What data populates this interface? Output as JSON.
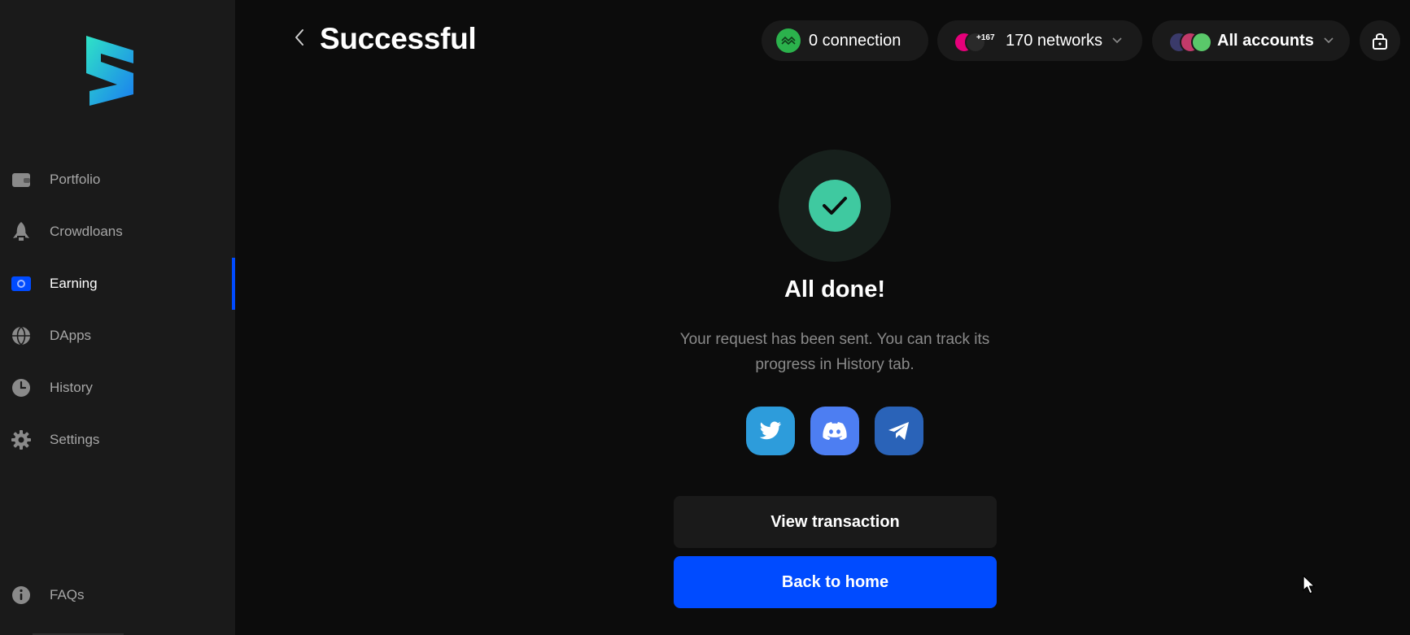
{
  "sidebar": {
    "items": [
      {
        "label": "Portfolio",
        "icon": "wallet-icon"
      },
      {
        "label": "Crowdloans",
        "icon": "rocket-icon"
      },
      {
        "label": "Earning",
        "icon": "earning-icon",
        "active": true
      },
      {
        "label": "DApps",
        "icon": "globe-icon"
      },
      {
        "label": "History",
        "icon": "clock-icon"
      },
      {
        "label": "Settings",
        "icon": "gear-icon"
      }
    ],
    "faq": {
      "label": "FAQs",
      "icon": "info-icon"
    }
  },
  "header": {
    "title": "Successful",
    "connection_label": "0 connection",
    "networks_label": "170 networks",
    "networks_badge": "+167",
    "accounts_label": "All accounts"
  },
  "main": {
    "title": "All done!",
    "description": "Your request has been sent. You can track its progress in History tab.",
    "social": [
      "twitter-icon",
      "discord-icon",
      "telegram-icon"
    ],
    "view_button": "View transaction",
    "home_button": "Back to home"
  },
  "colors": {
    "accent": "#004bff",
    "success": "#3fc9a0",
    "sidebar_bg": "#1a1a1a",
    "page_bg": "#0c0c0c"
  }
}
